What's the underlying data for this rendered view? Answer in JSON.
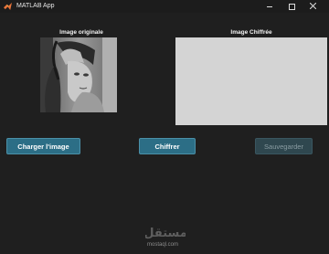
{
  "window": {
    "title": "MATLAB App"
  },
  "original": {
    "title": "Image originale"
  },
  "encrypted": {
    "title": "Image Chiffrée"
  },
  "buttons": {
    "load": "Charger l'image",
    "encrypt": "Chiffrer",
    "save": "Sauvegarder"
  },
  "watermark": {
    "logo": "مستقل",
    "text": "mostaql.com"
  },
  "colors": {
    "background": "#1f1f1f",
    "button": "#2c6e86",
    "button_disabled": "#2f474f",
    "image_placeholder": "#d4d4d4"
  }
}
